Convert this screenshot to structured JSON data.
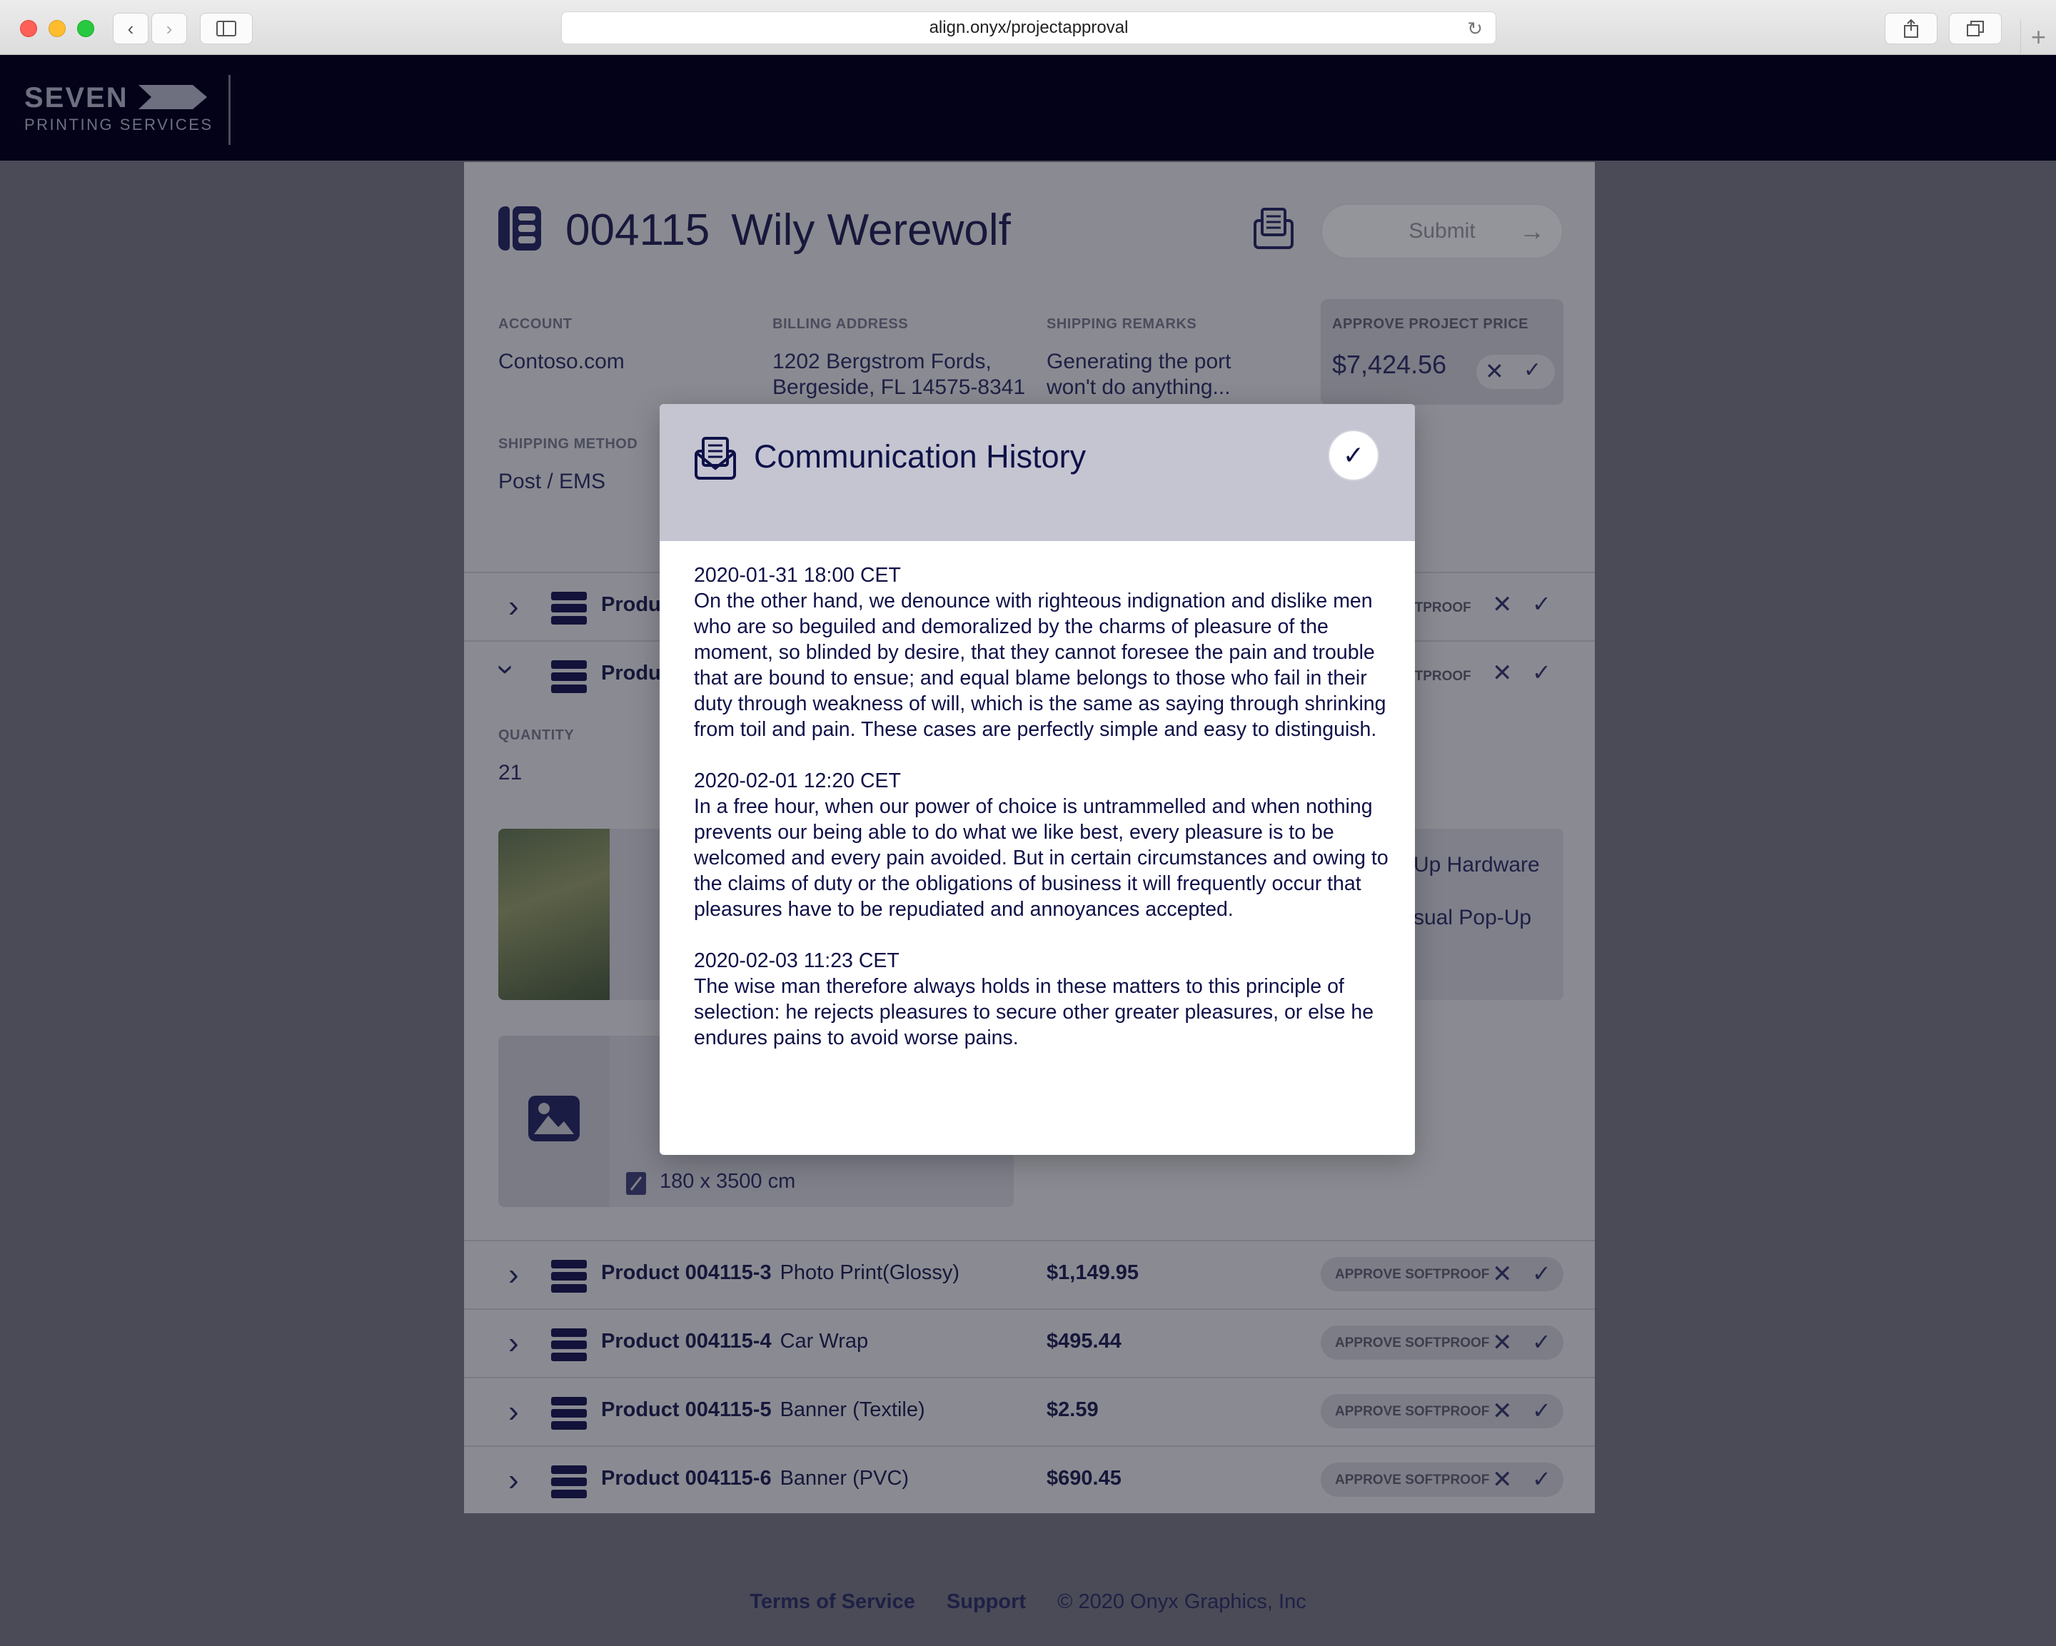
{
  "browser": {
    "url": "align.onyx/projectapproval"
  },
  "header": {
    "logo_line1": "SEVEN",
    "logo_line2": "PRINTING SERVICES"
  },
  "project": {
    "number": "004115",
    "name": "Wily Werewolf",
    "submit_label": "Submit",
    "account_label": "ACCOUNT",
    "account_value": "Contoso.com",
    "billing_label": "BILLING ADDRESS",
    "billing_line1": "1202 Bergstrom Fords,",
    "billing_line2": "Bergeside, FL 14575-8341",
    "shipping_remarks_label": "SHIPPING REMARKS",
    "shipping_remarks_line1": "Generating the port",
    "shipping_remarks_line2": "won't do anything...",
    "approve_price_label": "APPROVE PROJECT PRICE",
    "price": "$7,424.56",
    "shipping_method_label": "SHIPPING METHOD",
    "shipping_method_value": "Post / EMS",
    "quantity_label": "QUANTITY",
    "quantity_value": "21",
    "size_text": "180 x 3500 cm",
    "side_text1": "Up Hardware",
    "side_text2": "sual Pop-Up",
    "partial_product": "Produ",
    "partial_softproof": "FTPROOF"
  },
  "products": [
    {
      "id": "Product 004115-3",
      "type": "Photo Print(Glossy)",
      "price": "$1,149.95",
      "approve": "APPROVE SOFTPROOF"
    },
    {
      "id": "Product 004115-4",
      "type": "Car Wrap",
      "price": "$495.44",
      "approve": "APPROVE SOFTPROOF"
    },
    {
      "id": "Product 004115-5",
      "type": "Banner (Textile)",
      "price": "$2.59",
      "approve": "APPROVE SOFTPROOF"
    },
    {
      "id": "Product 004115-6",
      "type": "Banner (PVC)",
      "price": "$690.45",
      "approve": "APPROVE SOFTPROOF"
    }
  ],
  "modal": {
    "title": "Communication History",
    "entries": [
      {
        "timestamp": "2020-01-31 18:00 CET",
        "text": "On the other hand, we denounce with righteous indignation and dislike men who are so beguiled and demoralized by the charms of pleasure of the moment, so blinded by desire, that they cannot foresee the pain and trouble that are bound to ensue; and equal blame belongs to those who fail in their duty through weakness of will, which is the same as saying through shrinking from toil and pain. These cases are perfectly simple and easy to distinguish."
      },
      {
        "timestamp": "2020-02-01 12:20 CET",
        "text": "In a free hour, when our power of choice is untrammelled and when nothing prevents our being able to do what we like best, every pleasure is to be welcomed and every pain avoided. But in certain circumstances and owing to the claims of duty or the obligations of business it will frequently occur that pleasures have to be repudiated and annoyances accepted."
      },
      {
        "timestamp": "2020-02-03 11:23 CET",
        "text": "The wise man therefore always holds in these matters to this principle of selection: he rejects pleasures to secure other greater pleasures, or else he endures pains to avoid worse pains."
      }
    ]
  },
  "footer": {
    "terms": "Terms of Service",
    "support": "Support",
    "copyright": "© 2020 Onyx Graphics, Inc"
  },
  "icons": {
    "back": "chevron-left-icon",
    "forward": "chevron-right-icon",
    "sidebar": "sidebar-icon",
    "reload": "reload-icon",
    "share": "share-icon",
    "tabs": "tabs-icon",
    "new_tab": "plus-icon",
    "communication": "envelope-letter-icon",
    "confirm": "checkmark-icon"
  }
}
